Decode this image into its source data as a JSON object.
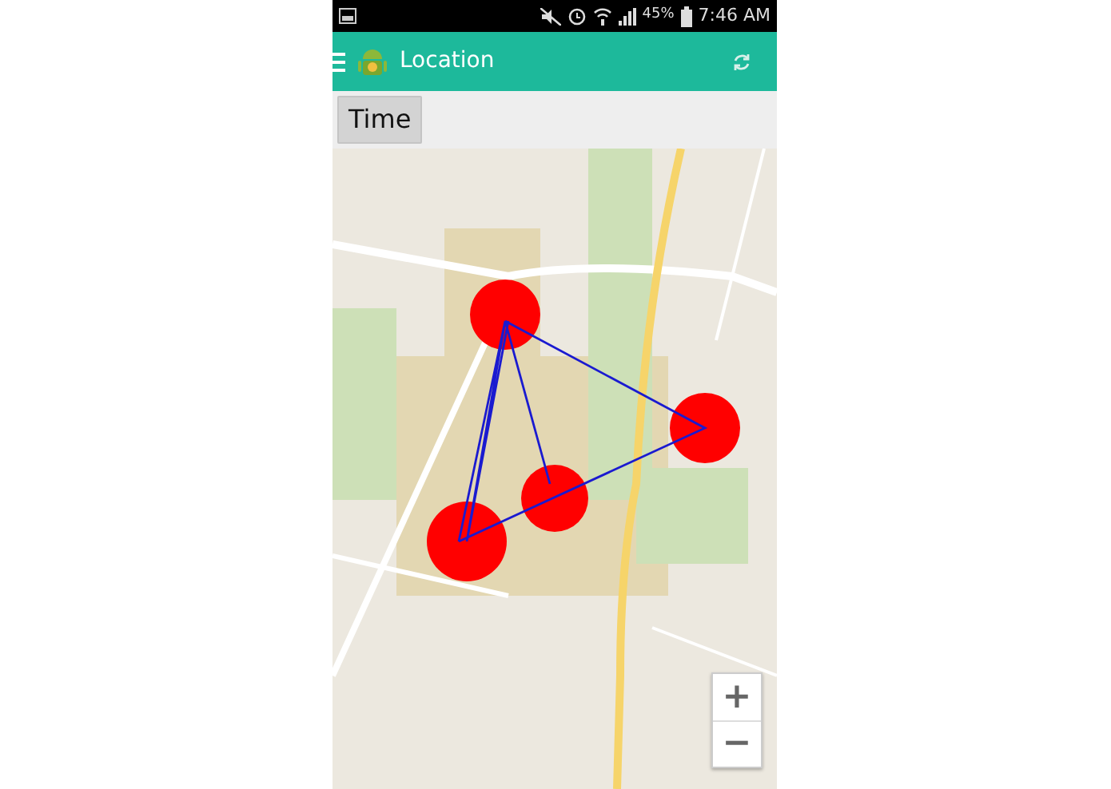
{
  "status_bar": {
    "battery": "45%",
    "time": "7:46 AM"
  },
  "app_bar": {
    "title": "Location"
  },
  "toolbar": {
    "buttons": [
      "Time"
    ]
  },
  "map": {
    "zoom_controls": [
      "+",
      "−"
    ]
  }
}
